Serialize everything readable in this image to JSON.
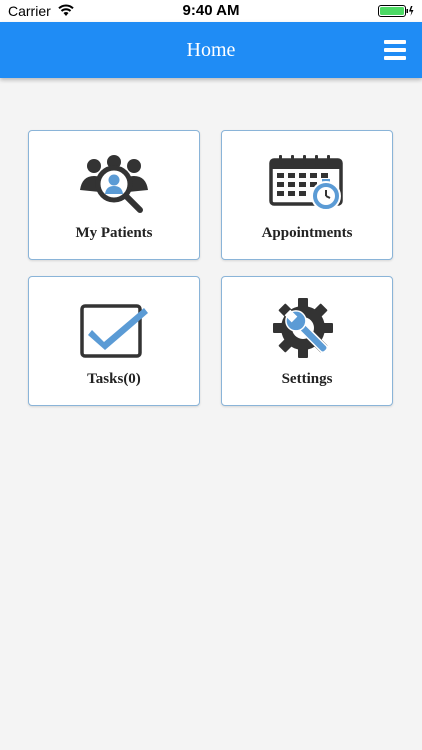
{
  "status_bar": {
    "carrier": "Carrier",
    "time": "9:40 AM"
  },
  "header": {
    "title": "Home",
    "menu_icon": "hamburger-menu-icon"
  },
  "tiles": [
    {
      "label": "My Patients",
      "icon": "patients-search-icon"
    },
    {
      "label": "Appointments",
      "icon": "calendar-clock-icon"
    },
    {
      "label": "Tasks(0)",
      "icon": "checkbox-icon"
    },
    {
      "label": "Settings",
      "icon": "gear-wrench-icon"
    }
  ],
  "colors": {
    "accent": "#1f8cf5",
    "icon_dark": "#333333",
    "icon_blue": "#5b9bd5",
    "tile_border": "#8ab4d8",
    "background": "#f4f4f4"
  }
}
